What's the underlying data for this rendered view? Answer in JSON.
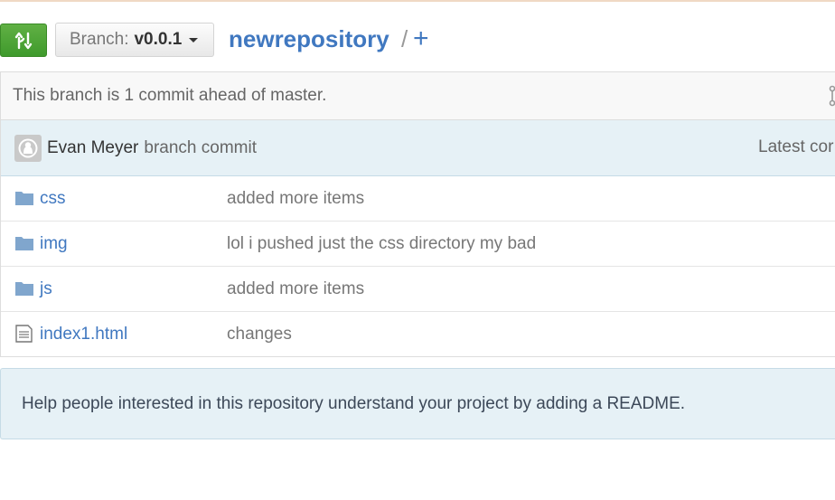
{
  "toolbar": {
    "branch_label": "Branch:",
    "branch_value": "v0.0.1",
    "repo_name": "newrepository",
    "separator": "/",
    "plus": "+"
  },
  "branch_status": {
    "text": "This branch is 1 commit ahead of master."
  },
  "commit": {
    "author": "Evan Meyer",
    "message": "branch commit",
    "latest_label": "Latest cor"
  },
  "files": [
    {
      "icon": "folder-icon",
      "name": "css",
      "message": "added more items"
    },
    {
      "icon": "folder-icon",
      "name": "img",
      "message": "lol i pushed just the css directory my bad"
    },
    {
      "icon": "folder-icon",
      "name": "js",
      "message": "added more items"
    },
    {
      "icon": "file-text-icon",
      "name": "index1.html",
      "message": "changes"
    }
  ],
  "readme_prompt": "Help people interested in this repository understand your project by adding a README.",
  "colors": {
    "accent_green": "#60b044",
    "link_blue": "#4078c0",
    "commit_bg": "#e6f1f6"
  }
}
